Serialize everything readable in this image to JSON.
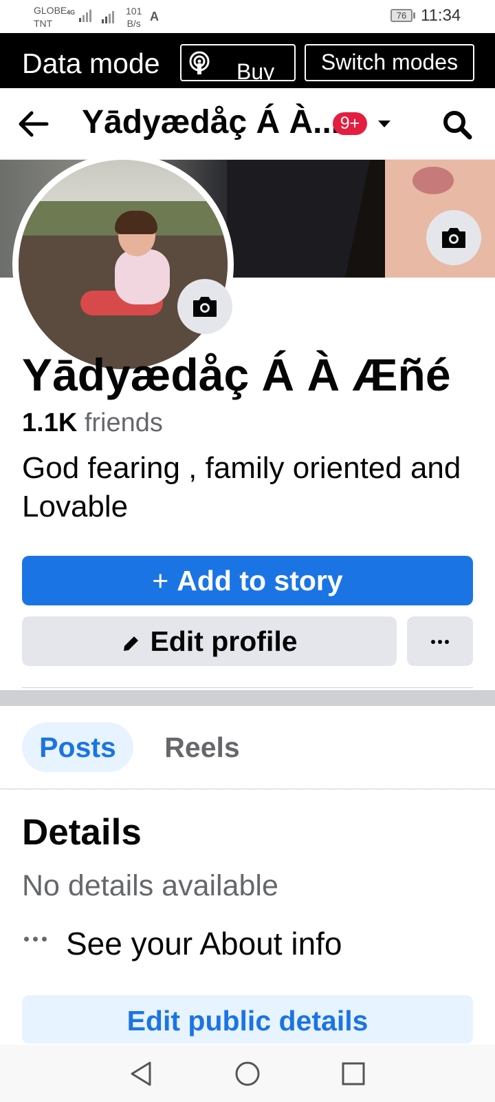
{
  "status_bar": {
    "carrier_line1": "GLOBE",
    "carrier_line2": "TNT",
    "network_type": "4G",
    "speed_value": "101",
    "speed_unit": "B/s",
    "battery": "76",
    "time": "11:34"
  },
  "data_mode_banner": {
    "title": "Data mode",
    "buy_label": "Buy",
    "switch_label": "Switch modes"
  },
  "nav": {
    "title": "Yādyædåç Á À...",
    "badge": "9+"
  },
  "profile": {
    "name": "Yādyædåç Á À Æñé",
    "friends_count": "1.1K",
    "friends_label": "friends",
    "bio": "God fearing , family oriented and Lovable"
  },
  "actions": {
    "add_story_plus": "+",
    "add_story_label": "Add to story",
    "edit_profile_label": "Edit profile"
  },
  "tabs": [
    {
      "label": "Posts",
      "selected": true
    },
    {
      "label": "Reels",
      "selected": false
    }
  ],
  "details": {
    "title": "Details",
    "empty_text": "No details available",
    "about_link": "See your About info",
    "edit_public_label": "Edit public details"
  },
  "colors": {
    "accent": "#1b74e4",
    "badge": "#e41e3f",
    "banner_bg": "#000000"
  },
  "icons": {
    "back": "arrow-left-icon",
    "search": "search-icon",
    "camera": "camera-icon",
    "pencil": "pencil-icon",
    "more": "more-horizontal-icon",
    "buy": "wifi-signal-icon"
  }
}
